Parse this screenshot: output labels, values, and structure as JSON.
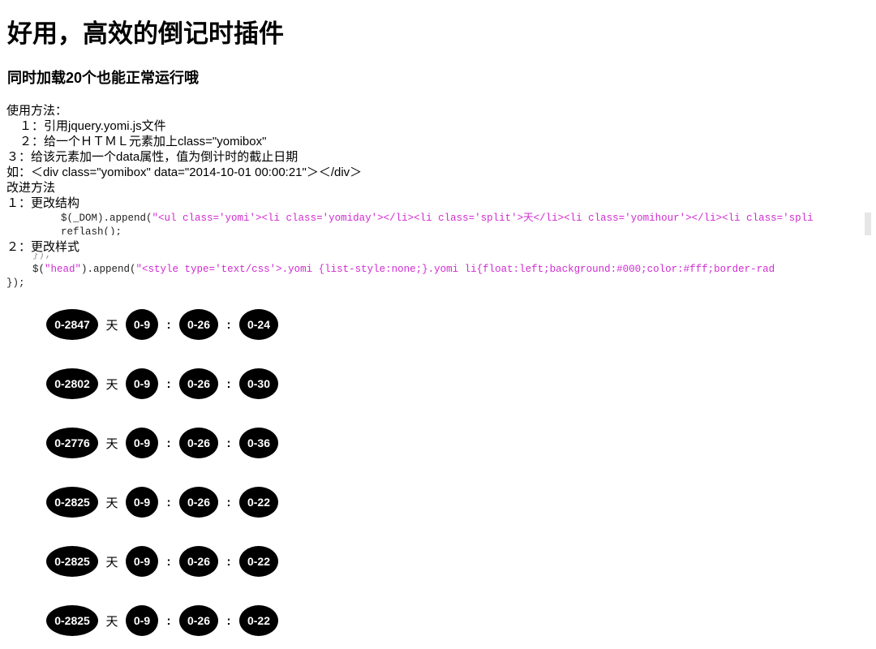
{
  "title": "好用，高效的倒记时插件",
  "subtitle": "同时加载20个也能正常运行哦",
  "usage": {
    "heading": "使用方法：",
    "steps": [
      "１：引用jquery.yomi.js文件",
      "２：给一个ＨＴＭＬ元素加上class=\"yomibox\"",
      "３：给该元素加一个data属性，值为倒计时的截止日期"
    ],
    "example": "如：＜div class=\"yomibox\" data=\"2014-10-01 00:00:21\"＞＜/div＞"
  },
  "improve": {
    "heading": "改进方法",
    "item1_label": "１：更改结构",
    "item1_code_prefix": "$(_DOM).append(",
    "item1_code_string": "\"<ul class='yomi'><li class='yomiday'></li><li class='split'>天</li><li class='yomihour'></li><li class='spli",
    "item1_code_next": "reflash();",
    "item2_label": "２：更改样式",
    "item2_code_prev": "});",
    "item2_code_prefix": "$(",
    "item2_code_head": "\"head\"",
    "item2_code_mid": ").append(",
    "item2_code_string": "\"<style type='text/css'>.yomi {list-style:none;}.yomi li{float:left;background:#000;color:#fff;border-rad",
    "item2_code_end": "});"
  },
  "separators": {
    "day": "天",
    "colon": ":"
  },
  "countdowns": [
    {
      "day": "0-2847",
      "hour": "0-9",
      "min": "0-26",
      "sec": "0-24"
    },
    {
      "day": "0-2802",
      "hour": "0-9",
      "min": "0-26",
      "sec": "0-30"
    },
    {
      "day": "0-2776",
      "hour": "0-9",
      "min": "0-26",
      "sec": "0-36"
    },
    {
      "day": "0-2825",
      "hour": "0-9",
      "min": "0-26",
      "sec": "0-22"
    },
    {
      "day": "0-2825",
      "hour": "0-9",
      "min": "0-26",
      "sec": "0-22"
    },
    {
      "day": "0-2825",
      "hour": "0-9",
      "min": "0-26",
      "sec": "0-22"
    }
  ]
}
